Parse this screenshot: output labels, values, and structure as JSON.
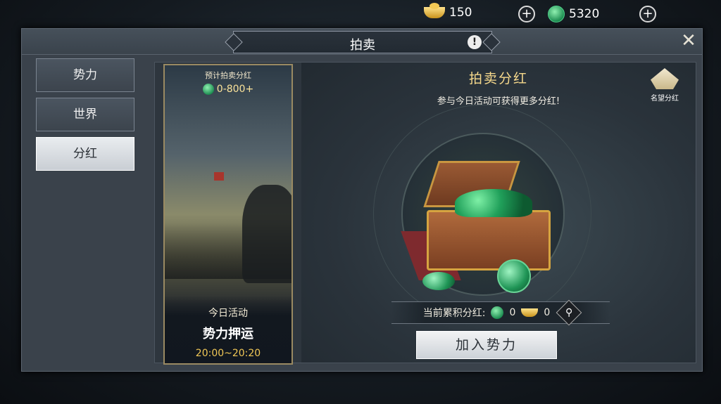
{
  "resources": {
    "gold": "150",
    "jade": "5320"
  },
  "window": {
    "title": "拍卖"
  },
  "sidebar": {
    "items": [
      {
        "label": "势力",
        "active": false
      },
      {
        "label": "世界",
        "active": false
      },
      {
        "label": "分红",
        "active": true
      }
    ]
  },
  "event_card": {
    "estimate_label": "预计拍卖分红",
    "estimate_value": "0-800+",
    "today_label": "今日活动",
    "event_name": "势力押运",
    "time": "20:00~20:20"
  },
  "dividend": {
    "title": "拍卖分红",
    "subtitle": "参与今日活动可获得更多分红!",
    "fame_label": "名望分红",
    "accum_label": "当前累积分红:",
    "accum_jade": "0",
    "accum_gold": "0",
    "join_label": "加入势力"
  },
  "colors": {
    "accent_gold": "#f6d98c",
    "jade": "#1f8f53"
  }
}
